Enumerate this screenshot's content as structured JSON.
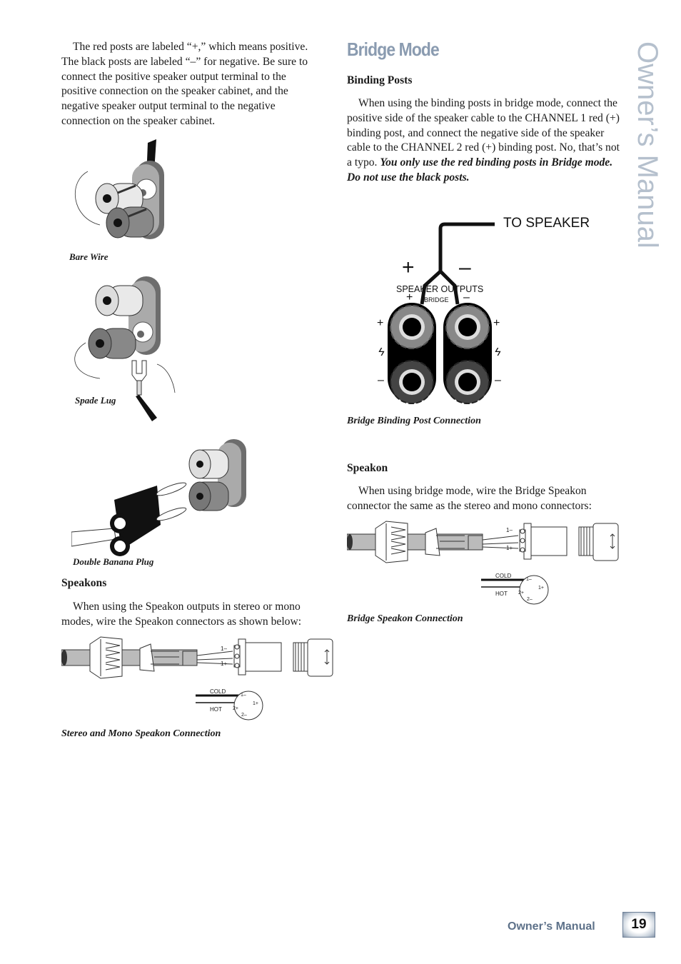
{
  "left_column": {
    "intro_paragraph": "The red posts are labeled “+,” which means positive. The black posts are labeled “–” for negative. Be sure to connect the positive speaker output terminal to the positive connection on the speaker cabinet, and the negative speaker output terminal to the negative connection on the speaker cabinet.",
    "figures": {
      "bare_wire": "Bare Wire",
      "spade_lug": "Spade Lug",
      "double_banana": "Double Banana Plug"
    },
    "speakons": {
      "heading": "Speakons",
      "paragraph": "When using the Speakon outputs in stereo or mono modes, wire the Speakon connectors as shown below:",
      "caption": "Stereo and Mono Speakon Connection"
    }
  },
  "right_column": {
    "section_title": "Bridge Mode",
    "binding_posts": {
      "heading": "Binding Posts",
      "paragraph_plain": "When using the binding posts in bridge mode, connect the positive side of the speaker cable to the CHANNEL 1 red (+) binding post, and connect the negative side of the speaker cable to the CHANNEL 2 red (+) binding post. No, that’s not a typo. ",
      "paragraph_emphasis": "You only use the red binding posts in Bridge mode. Do not use the black posts.",
      "caption": "Bridge Binding Post Connection"
    },
    "bridge_diagram": {
      "to_speaker": "TO SPEAKER",
      "plus": "+",
      "minus": "–",
      "speaker_outputs": "SPEAKER OUTPUTS",
      "bridge": "BRIDGE",
      "bridge_plus": "+",
      "bridge_minus": "–",
      "left_plus": "+",
      "left_minus": "–",
      "right_plus": "+",
      "right_minus": "–",
      "bolt": "ϟ"
    },
    "speakon": {
      "heading": "Speakon",
      "paragraph": "When using bridge mode, wire the Bridge Speakon connector the same as the stereo and mono connectors:",
      "caption": "Bridge Speakon Connection"
    }
  },
  "speakon_diagram_labels": {
    "pin_1_minus": "1–",
    "pin_1_plus": "1+",
    "cold": "COLD",
    "hot": "HOT",
    "face_1_minus": "1–",
    "face_1_plus": "1+",
    "face_2_plus": "2+",
    "face_2_minus": "2–"
  },
  "side_title": "Owner’s Manual",
  "footer": {
    "label": "Owner’s Manual",
    "page_number": "19"
  }
}
